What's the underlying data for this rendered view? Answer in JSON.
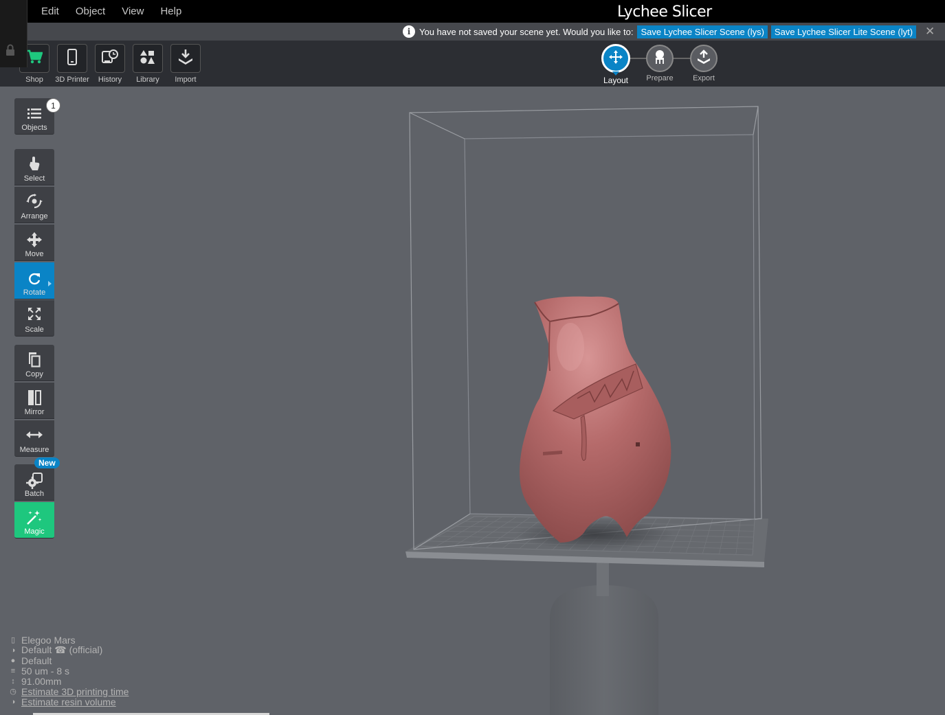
{
  "menu": {
    "items": [
      "Edit",
      "Object",
      "View",
      "Help"
    ],
    "app_title": "Lychee Slicer"
  },
  "notification": {
    "message": "You have not saved your scene yet. Would you like to:",
    "save_lys": "Save Lychee Slicer Scene (lys)",
    "save_lyt": "Save Lychee Slicer Lite Scene (lyt)",
    "close": "✕"
  },
  "toolbar": {
    "shop": "Shop",
    "printer": "3D Printer",
    "history": "History",
    "library": "Library",
    "import": "Import"
  },
  "workflow": {
    "layout": "Layout",
    "prepare": "Prepare",
    "export": "Export",
    "active": "Layout"
  },
  "sidebar": {
    "objects": "Objects",
    "objects_count": "1",
    "select": "Select",
    "arrange": "Arrange",
    "move": "Move",
    "rotate": "Rotate",
    "scale": "Scale",
    "copy": "Copy",
    "mirror": "Mirror",
    "measure": "Measure",
    "batch": "Batch",
    "batch_badge": "New",
    "magic": "Magic"
  },
  "status": {
    "printer": "Elegoo Mars",
    "resin": "Default ☎ (official)",
    "color": "Default",
    "layer": "50 um - 8 s",
    "height": "91.00mm",
    "estimate_time": "Estimate 3D printing time",
    "estimate_resin": "Estimate resin volume"
  },
  "colors": {
    "accent": "#0a84c6",
    "magic": "#1ec77e",
    "shop_icon": "#1ec77e",
    "model": "#b86b6b",
    "background": "#5f6268"
  },
  "icons": {
    "shop": "cart-icon",
    "printer": "phone-printer-icon",
    "history": "history-icon",
    "library": "shapes-icon",
    "import": "import-icon"
  }
}
